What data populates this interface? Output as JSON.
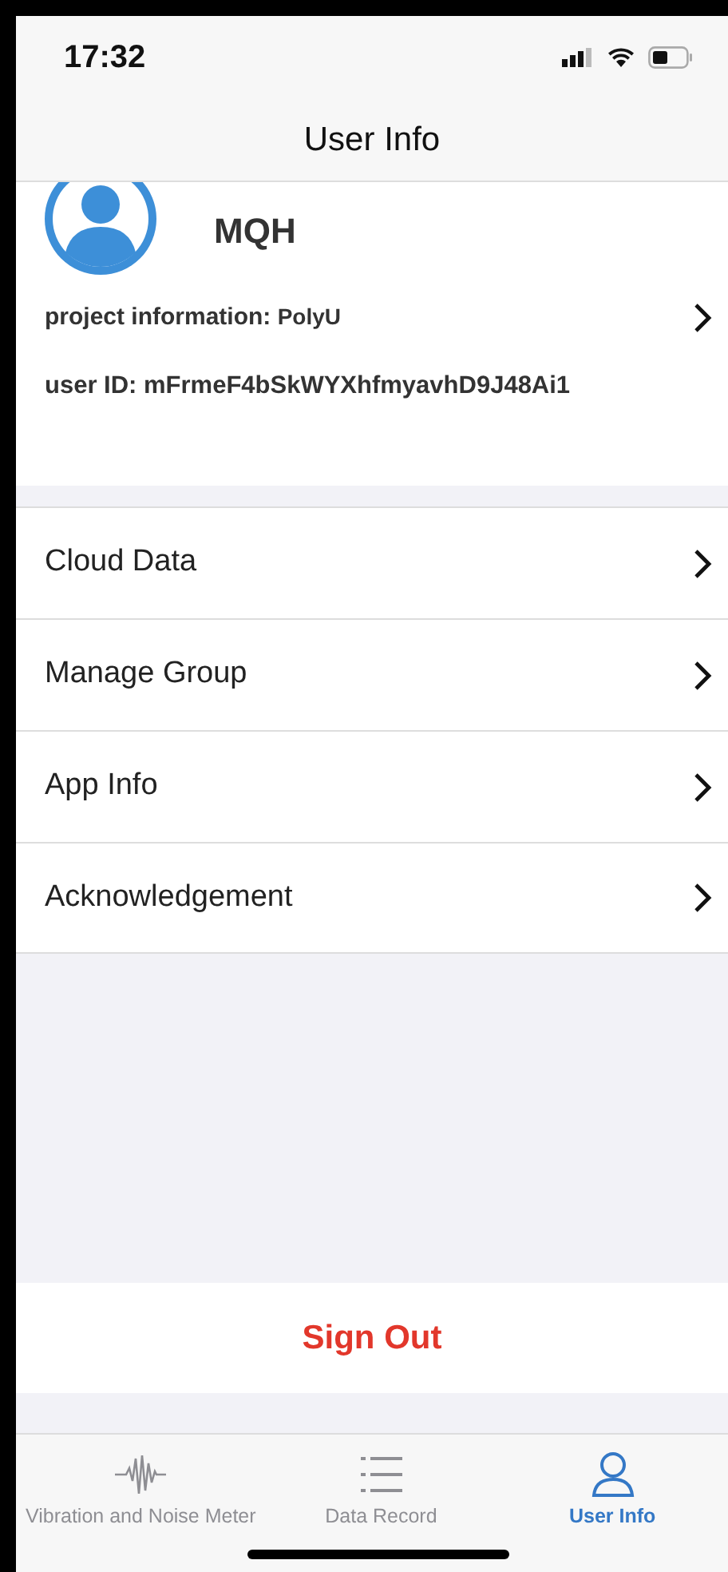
{
  "status_bar": {
    "time": "17:32"
  },
  "nav": {
    "title": "User Info"
  },
  "profile": {
    "name": "MQH",
    "project_label": "project information:",
    "project_value": "PolyU",
    "user_id": "user ID: mFrmeF4bSkWYXhfmyavhD9J48Ai1"
  },
  "menu": [
    {
      "label": "Cloud Data"
    },
    {
      "label": "Manage Group"
    },
    {
      "label": "App Info"
    },
    {
      "label": "Acknowledgement"
    }
  ],
  "sign_out": "Sign Out",
  "tabs": [
    {
      "label": "Vibration and Noise Meter",
      "kind": "wave",
      "selected": false
    },
    {
      "label": "Data Record",
      "kind": "list",
      "selected": false
    },
    {
      "label": "User Info",
      "kind": "person",
      "selected": true
    }
  ]
}
